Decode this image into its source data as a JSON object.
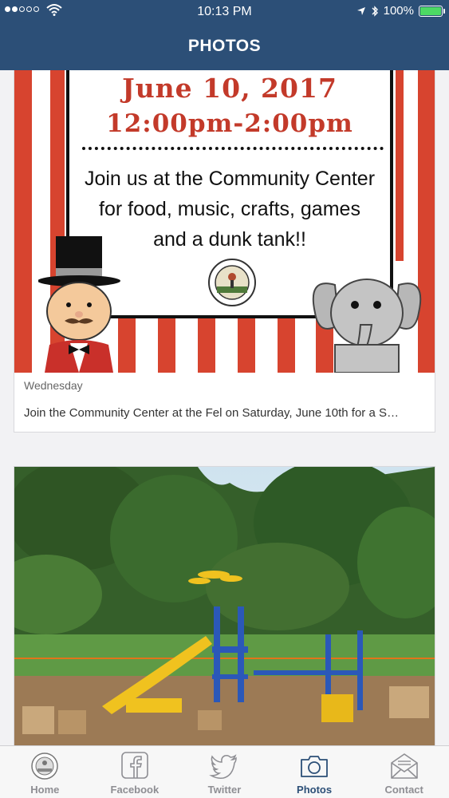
{
  "status_bar": {
    "time": "10:13 PM",
    "battery": "100%",
    "signal_bars_filled": 2,
    "signal_bars_total": 5
  },
  "header": {
    "title": "PHOTOS",
    "background_color": "#2c4f77"
  },
  "feed": {
    "posts": [
      {
        "image_icon": "event-flyer-image",
        "flyer": {
          "date": "June 10, 2017",
          "time": "12:00pm-2:00pm",
          "lines": [
            "Join us at the Community Center",
            "for food, music, crafts, games",
            "and a dunk tank!!"
          ]
        },
        "day": "Wednesday",
        "description": "Join the Community Center at the Fel on Saturday, June 10th for a S…"
      },
      {
        "image_icon": "playground-construction-photo"
      }
    ]
  },
  "tab_bar": {
    "active_tab": "Photos",
    "tabs": [
      {
        "label": "Home",
        "icon": "home-seal-icon"
      },
      {
        "label": "Facebook",
        "icon": "facebook-icon"
      },
      {
        "label": "Twitter",
        "icon": "twitter-icon"
      },
      {
        "label": "Photos",
        "icon": "camera-icon"
      },
      {
        "label": "Contact",
        "icon": "envelope-icon"
      }
    ],
    "active_color": "#2c4f77",
    "inactive_color": "#8e8e93"
  }
}
